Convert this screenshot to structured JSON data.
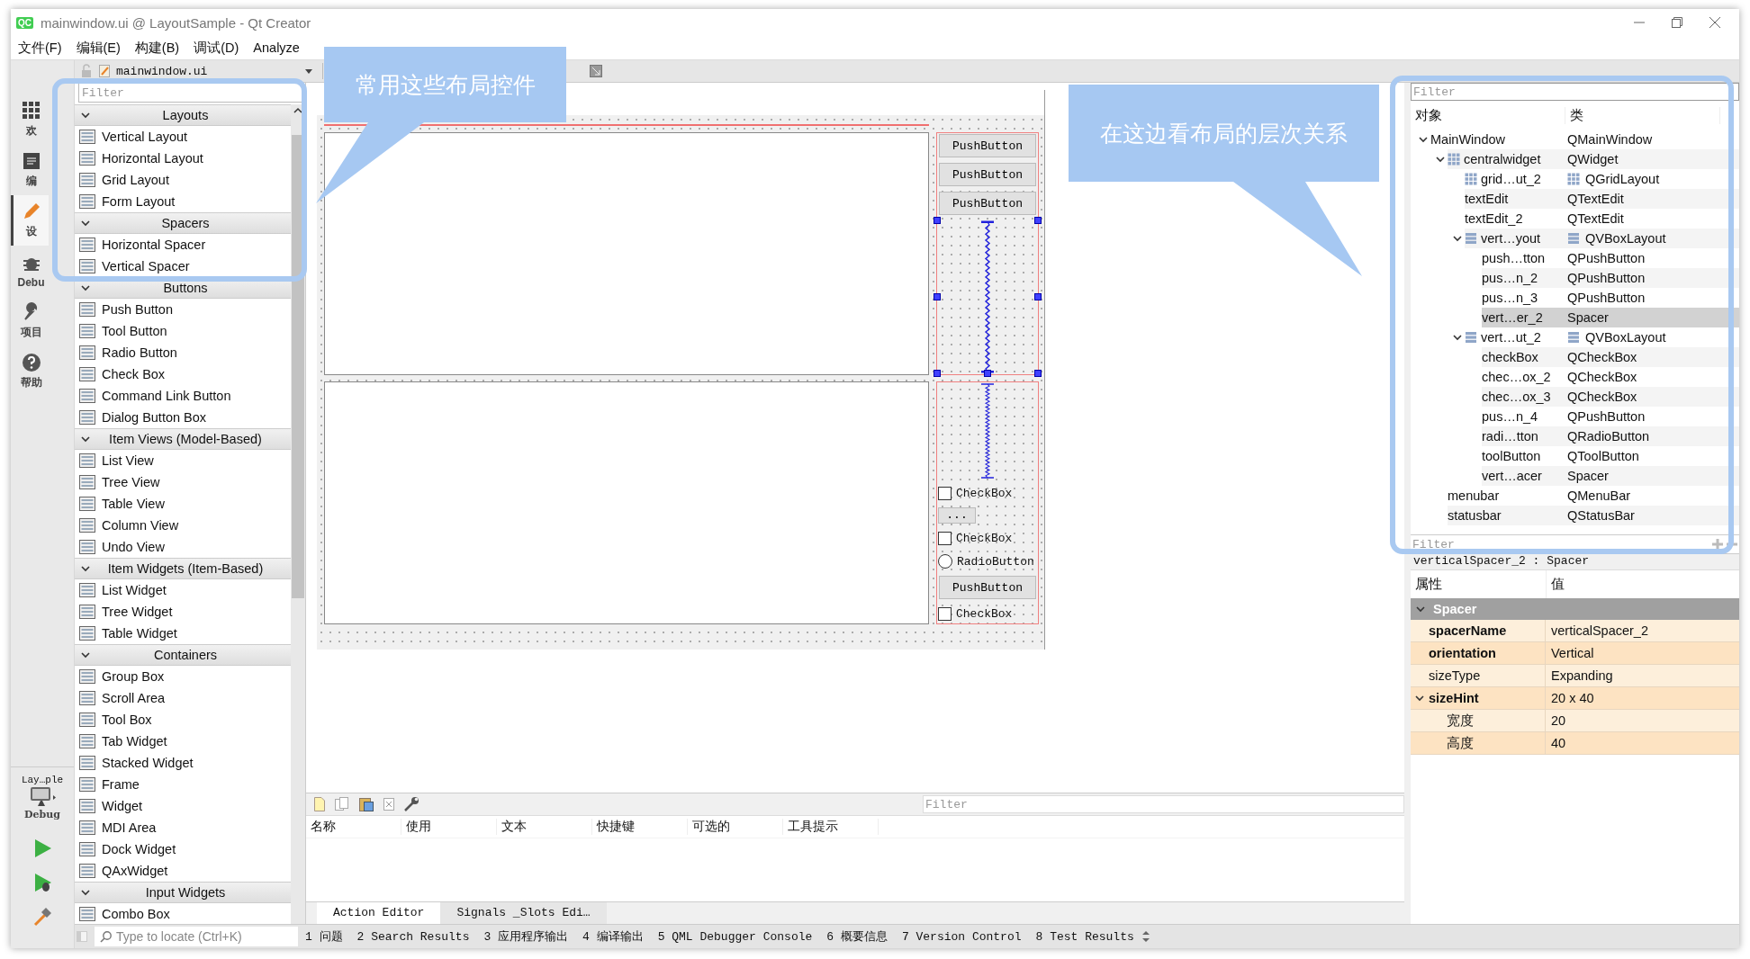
{
  "window": {
    "title": "mainwindow.ui @ LayoutSample - Qt Creator",
    "app_icon": "QC"
  },
  "menu_bar": [
    {
      "label": "文件(F)"
    },
    {
      "label": "编辑(E)"
    },
    {
      "label": "构建(B)"
    },
    {
      "label": "调试(D)"
    },
    {
      "label": "Analyze"
    }
  ],
  "mode_bar": {
    "modes": [
      {
        "label": "欢",
        "selected": false
      },
      {
        "label": "编",
        "selected": false
      },
      {
        "label": "设",
        "selected": true
      },
      {
        "label": "Debu",
        "selected": false
      },
      {
        "label": "项目",
        "selected": false
      },
      {
        "label": "帮助",
        "selected": false
      }
    ],
    "target": {
      "project": "Lay…ple",
      "config": "Debug"
    }
  },
  "editor_toolbar": {
    "file": "mainwindow.ui"
  },
  "widget_box": {
    "filter": {
      "placeholder": "Filter"
    },
    "categories": [
      {
        "name": "Layouts",
        "expanded": true,
        "items": [
          "Vertical Layout",
          "Horizontal Layout",
          "Grid Layout",
          "Form Layout"
        ]
      },
      {
        "name": "Spacers",
        "expanded": true,
        "items": [
          "Horizontal Spacer",
          "Vertical Spacer"
        ]
      },
      {
        "name": "Buttons",
        "expanded": true,
        "items": [
          "Push Button",
          "Tool Button",
          "Radio Button",
          "Check Box",
          "Command Link Button",
          "Dialog Button Box"
        ]
      },
      {
        "name": "Item Views (Model-Based)",
        "expanded": true,
        "items": [
          "List View",
          "Tree View",
          "Table View",
          "Column View",
          "Undo View"
        ]
      },
      {
        "name": "Item Widgets (Item-Based)",
        "expanded": true,
        "items": [
          "List Widget",
          "Tree Widget",
          "Table Widget"
        ]
      },
      {
        "name": "Containers",
        "expanded": true,
        "items": [
          "Group Box",
          "Scroll Area",
          "Tool Box",
          "Tab Widget",
          "Stacked Widget",
          "Frame",
          "Widget",
          "MDI Area",
          "Dock Widget",
          "QAxWidget"
        ]
      },
      {
        "name": "Input Widgets",
        "expanded": true,
        "items": [
          "Combo Box"
        ]
      }
    ]
  },
  "form": {
    "top_column": [
      {
        "kind": "button",
        "text": "PushButton"
      },
      {
        "kind": "button",
        "text": "PushButton"
      },
      {
        "kind": "button",
        "text": "PushButton"
      },
      {
        "kind": "spacer",
        "selected": true
      }
    ],
    "bottom_column": [
      {
        "kind": "spacer",
        "selected": false
      },
      {
        "kind": "checkbox",
        "text": "CheckBox",
        "checked": false
      },
      {
        "kind": "toolbutton",
        "text": "..."
      },
      {
        "kind": "checkbox",
        "text": "CheckBox",
        "checked": false
      },
      {
        "kind": "radio",
        "text": "RadioButton",
        "checked": false
      },
      {
        "kind": "button",
        "text": "PushButton"
      },
      {
        "kind": "checkbox",
        "text": "CheckBox",
        "checked": false
      }
    ]
  },
  "action_editor": {
    "filter": {
      "placeholder": "Filter"
    },
    "columns": [
      "名称",
      "使用",
      "文本",
      "快捷键",
      "可选的",
      "工具提示"
    ],
    "tabs": [
      {
        "label": "Action Editor",
        "selected": true
      },
      {
        "label": "Signals _Slots Edi…",
        "selected": false
      }
    ]
  },
  "object_inspector": {
    "filter": {
      "placeholder": "Filter"
    },
    "columns": [
      "对象",
      "类"
    ],
    "tree": [
      {
        "name": "MainWindow",
        "class": "QMainWindow",
        "expanded": true,
        "selected": false,
        "children": [
          {
            "name": "centralwidget",
            "class": "QWidget",
            "kind": "grid-owner",
            "expanded": true,
            "selected": false,
            "children": [
              {
                "name": "grid…ut_2",
                "class": "QGridLayout",
                "kind": "grid-layout",
                "selected": false
              },
              {
                "name": "textEdit",
                "class": "QTextEdit",
                "selected": false
              },
              {
                "name": "textEdit_2",
                "class": "QTextEdit",
                "selected": false
              },
              {
                "name": "vert…yout",
                "class": "QVBoxLayout",
                "kind": "vbox-layout",
                "expanded": true,
                "selected": false,
                "children": [
                  {
                    "name": "push…tton",
                    "class": "QPushButton",
                    "selected": false
                  },
                  {
                    "name": "pus…n_2",
                    "class": "QPushButton",
                    "selected": false
                  },
                  {
                    "name": "pus…n_3",
                    "class": "QPushButton",
                    "selected": false
                  },
                  {
                    "name": "vert…er_2",
                    "class": "Spacer",
                    "selected": true
                  }
                ]
              },
              {
                "name": "vert…ut_2",
                "class": "QVBoxLayout",
                "kind": "vbox-layout",
                "expanded": true,
                "selected": false,
                "children": [
                  {
                    "name": "checkBox",
                    "class": "QCheckBox",
                    "selected": false
                  },
                  {
                    "name": "chec…ox_2",
                    "class": "QCheckBox",
                    "selected": false
                  },
                  {
                    "name": "chec…ox_3",
                    "class": "QCheckBox",
                    "selected": false
                  },
                  {
                    "name": "pus…n_4",
                    "class": "QPushButton",
                    "selected": false
                  },
                  {
                    "name": "radi…tton",
                    "class": "QRadioButton",
                    "selected": false
                  },
                  {
                    "name": "toolButton",
                    "class": "QToolButton",
                    "selected": false
                  },
                  {
                    "name": "vert…acer",
                    "class": "Spacer",
                    "selected": false
                  }
                ]
              }
            ]
          },
          {
            "name": "menubar",
            "class": "QMenuBar",
            "selected": false
          },
          {
            "name": "statusbar",
            "class": "QStatusBar",
            "selected": false
          }
        ]
      }
    ],
    "bottom_filter": {
      "placeholder": "Filter"
    }
  },
  "property_editor": {
    "header": "verticalSpacer_2 : Spacer",
    "columns": [
      "属性",
      "值"
    ],
    "groups": [
      {
        "name": "Spacer",
        "expanded": true,
        "properties": [
          {
            "name": "spacerName",
            "value": "verticalSpacer_2",
            "changed": true
          },
          {
            "name": "orientation",
            "value": "Vertical",
            "changed": true
          },
          {
            "name": "sizeType",
            "value": "Expanding",
            "changed": false
          },
          {
            "name": "sizeHint",
            "value": "20 x 40",
            "changed": true,
            "expanded": true,
            "children": [
              {
                "name": "宽度",
                "value": "20",
                "changed": false
              },
              {
                "name": "高度",
                "value": "40",
                "changed": false
              }
            ]
          }
        ]
      }
    ]
  },
  "output_bar": {
    "locator": {
      "placeholder": "Type to locate (Ctrl+K)"
    },
    "panes": [
      "1 问题",
      "2 Search Results",
      "3 应用程序输出",
      "4 编译输出",
      "5 QML Debugger Console",
      "6 概要信息",
      "7 Version Control",
      "8 Test Results"
    ]
  },
  "annotations": [
    {
      "text": "常用这些布局控件"
    },
    {
      "text": "在这边看布局的层次关系"
    }
  ]
}
